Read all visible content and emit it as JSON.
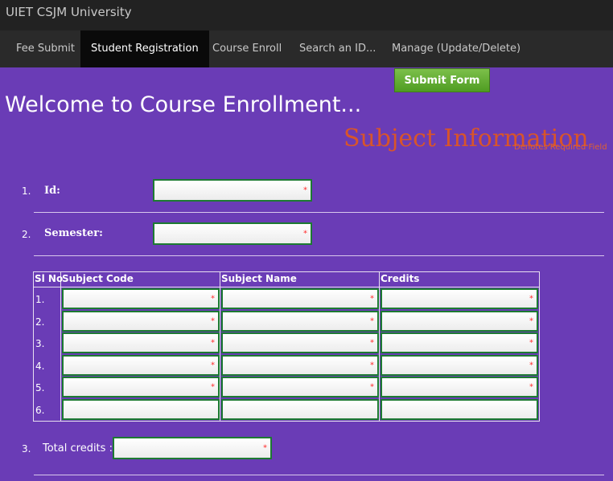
{
  "header": {
    "brand": "UIET CSJM University"
  },
  "nav": [
    {
      "label": "Fee Submit"
    },
    {
      "label": "Student Registration"
    },
    {
      "label": "Course Enroll"
    },
    {
      "label": "Search an ID..."
    },
    {
      "label": "Manage (Update/Delete)"
    }
  ],
  "submit_label": "Submit Form",
  "page_title": "Welcome to Course Enrollment...",
  "section_title": "Subject Information",
  "required_note": "Denotes Required Field",
  "required_mark": "*",
  "fields": [
    {
      "num": "1.",
      "label": "Id:",
      "value": ""
    },
    {
      "num": "2.",
      "label": "Semester:",
      "value": ""
    }
  ],
  "table": {
    "headers": [
      "Sl No",
      "Subject Code",
      "Subject Name",
      "Credits"
    ],
    "rows": [
      {
        "num": "1.",
        "code": "",
        "name": "",
        "credits": "",
        "required": true
      },
      {
        "num": "2.",
        "code": "",
        "name": "",
        "credits": "",
        "required": true
      },
      {
        "num": "3.",
        "code": "",
        "name": "",
        "credits": "",
        "required": true
      },
      {
        "num": "4.",
        "code": "",
        "name": "",
        "credits": "",
        "required": true
      },
      {
        "num": "5.",
        "code": "",
        "name": "",
        "credits": "",
        "required": true
      },
      {
        "num": "6.",
        "code": "",
        "name": "",
        "credits": "",
        "required": false
      }
    ]
  },
  "total": {
    "num": "3.",
    "label": "Total credits :",
    "value": ""
  },
  "colors": {
    "background": "#6a3cb6",
    "accent_green": "#4f9c22",
    "title_orange": "#d8552a"
  }
}
